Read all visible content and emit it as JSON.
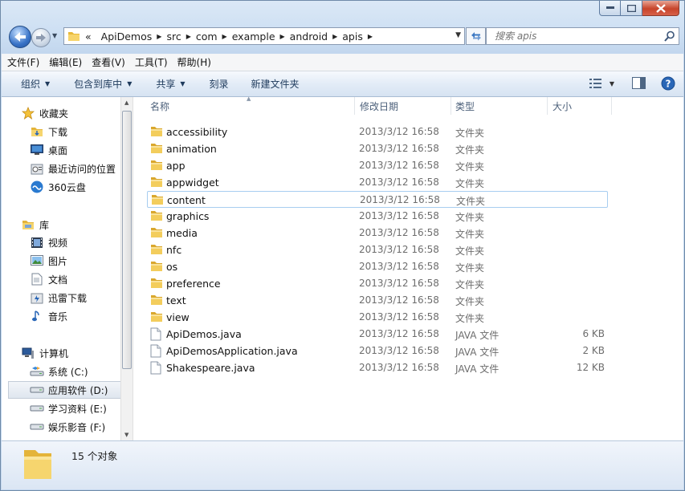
{
  "window": {
    "buttons": {
      "minimize": "minimize",
      "maximize": "maximize",
      "close": "close"
    }
  },
  "nav": {
    "breadcrumb_overflow": "«",
    "breadcrumbs": [
      "ApiDemos",
      "src",
      "com",
      "example",
      "android",
      "apis"
    ],
    "search_placeholder": "搜索 apis"
  },
  "menu": [
    "文件(F)",
    "编辑(E)",
    "查看(V)",
    "工具(T)",
    "帮助(H)"
  ],
  "commands": [
    "组织",
    "包含到库中",
    "共享",
    "刻录",
    "新建文件夹"
  ],
  "sidebar": [
    {
      "label": "收藏夹",
      "icon": "star-icon",
      "group": true
    },
    {
      "label": "下载",
      "icon": "download-folder-icon"
    },
    {
      "label": "桌面",
      "icon": "desktop-icon"
    },
    {
      "label": "最近访问的位置",
      "icon": "recent-places-icon"
    },
    {
      "label": "360云盘",
      "icon": "cloud-drive-icon"
    },
    {
      "label": "库",
      "icon": "library-icon",
      "group": true
    },
    {
      "label": "视频",
      "icon": "video-library-icon"
    },
    {
      "label": "图片",
      "icon": "picture-library-icon"
    },
    {
      "label": "文档",
      "icon": "document-library-icon"
    },
    {
      "label": "迅雷下载",
      "icon": "thunder-download-icon"
    },
    {
      "label": "音乐",
      "icon": "music-library-icon"
    },
    {
      "label": "计算机",
      "icon": "computer-icon",
      "group": true
    },
    {
      "label": "系统 (C:)",
      "icon": "system-drive-icon"
    },
    {
      "label": "应用软件 (D:)",
      "icon": "drive-icon",
      "selected": true
    },
    {
      "label": "学习资料 (E:)",
      "icon": "drive-icon"
    },
    {
      "label": "娱乐影音 (F:)",
      "icon": "drive-icon"
    }
  ],
  "columns": {
    "name": "名称",
    "date": "修改日期",
    "type": "类型",
    "size": "大小"
  },
  "files": [
    {
      "name": "accessibility",
      "date": "2013/3/12 16:58",
      "type": "文件夹",
      "size": "",
      "kind": "folder"
    },
    {
      "name": "animation",
      "date": "2013/3/12 16:58",
      "type": "文件夹",
      "size": "",
      "kind": "folder"
    },
    {
      "name": "app",
      "date": "2013/3/12 16:58",
      "type": "文件夹",
      "size": "",
      "kind": "folder"
    },
    {
      "name": "appwidget",
      "date": "2013/3/12 16:58",
      "type": "文件夹",
      "size": "",
      "kind": "folder"
    },
    {
      "name": "content",
      "date": "2013/3/12 16:58",
      "type": "文件夹",
      "size": "",
      "kind": "folder",
      "hover": true
    },
    {
      "name": "graphics",
      "date": "2013/3/12 16:58",
      "type": "文件夹",
      "size": "",
      "kind": "folder"
    },
    {
      "name": "media",
      "date": "2013/3/12 16:58",
      "type": "文件夹",
      "size": "",
      "kind": "folder"
    },
    {
      "name": "nfc",
      "date": "2013/3/12 16:58",
      "type": "文件夹",
      "size": "",
      "kind": "folder"
    },
    {
      "name": "os",
      "date": "2013/3/12 16:58",
      "type": "文件夹",
      "size": "",
      "kind": "folder"
    },
    {
      "name": "preference",
      "date": "2013/3/12 16:58",
      "type": "文件夹",
      "size": "",
      "kind": "folder"
    },
    {
      "name": "text",
      "date": "2013/3/12 16:58",
      "type": "文件夹",
      "size": "",
      "kind": "folder"
    },
    {
      "name": "view",
      "date": "2013/3/12 16:58",
      "type": "文件夹",
      "size": "",
      "kind": "folder"
    },
    {
      "name": "ApiDemos.java",
      "date": "2013/3/12 16:58",
      "type": "JAVA 文件",
      "size": "6 KB",
      "kind": "file"
    },
    {
      "name": "ApiDemosApplication.java",
      "date": "2013/3/12 16:58",
      "type": "JAVA 文件",
      "size": "2 KB",
      "kind": "file"
    },
    {
      "name": "Shakespeare.java",
      "date": "2013/3/12 16:58",
      "type": "JAVA 文件",
      "size": "12 KB",
      "kind": "file"
    }
  ],
  "status": {
    "count_text": "15 个对象"
  },
  "colors": {
    "frame": "#c3d7ee",
    "hover_border": "#a7cdf0",
    "folder": "#f0c24f"
  }
}
